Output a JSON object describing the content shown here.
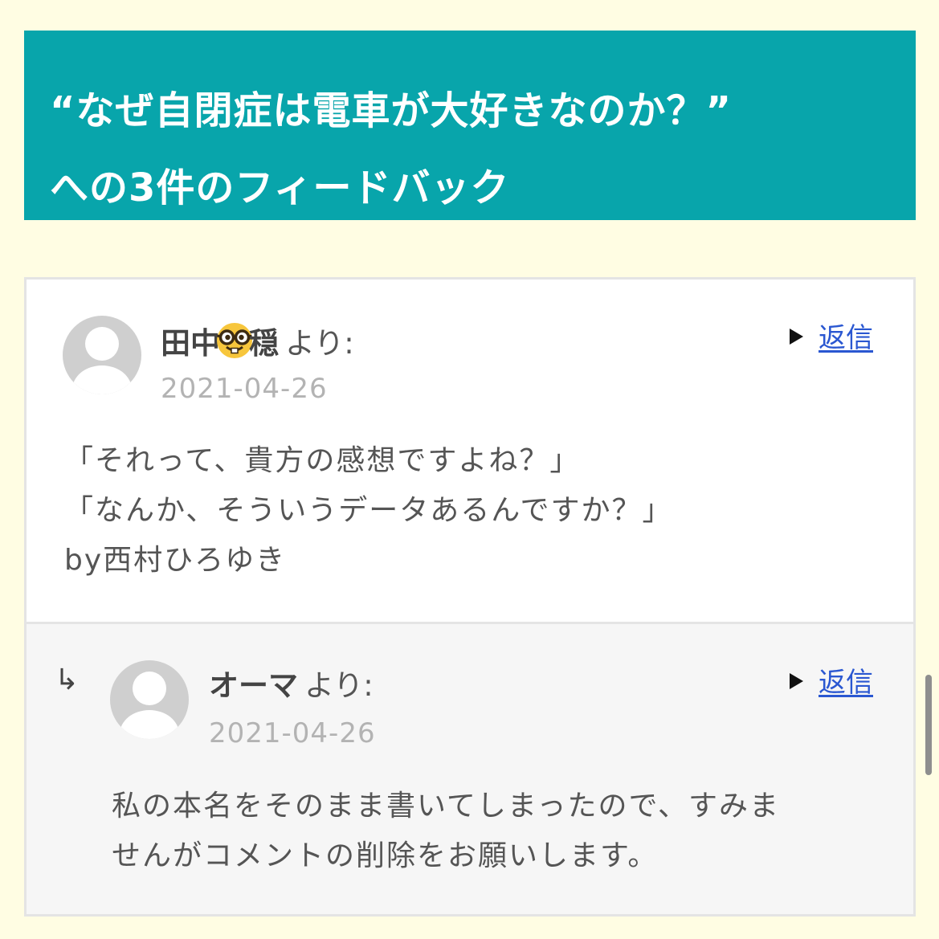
{
  "header": {
    "title_line1": "“なぜ自閉症は電車が大好きなのか？”",
    "title_line2": "への3件のフィードバック"
  },
  "comments": [
    {
      "author_before_emoji": "田中",
      "author_emoji": "nerd-face-icon",
      "author_after_emoji": "穏",
      "author_suffix": "より:",
      "date": "2021-04-26",
      "reply_label": "返信",
      "lines": [
        "「それって、貴方の感想ですよね？」",
        "「なんか、そういうデータあるんですか？」",
        "by西村ひろゆき"
      ]
    },
    {
      "indent_arrow": "↳",
      "author": "オーマ",
      "author_suffix": "より:",
      "date": "2021-04-26",
      "reply_label": "返信",
      "lines": [
        "私の本名をそのまま書いてしまったので、すみま",
        "せんがコメントの削除をお願いします。"
      ]
    }
  ],
  "colors": {
    "page_background": "#fffde3",
    "header_background": "#08a5ab",
    "link": "#2a57d1",
    "reply_background": "#f6f6f6"
  }
}
